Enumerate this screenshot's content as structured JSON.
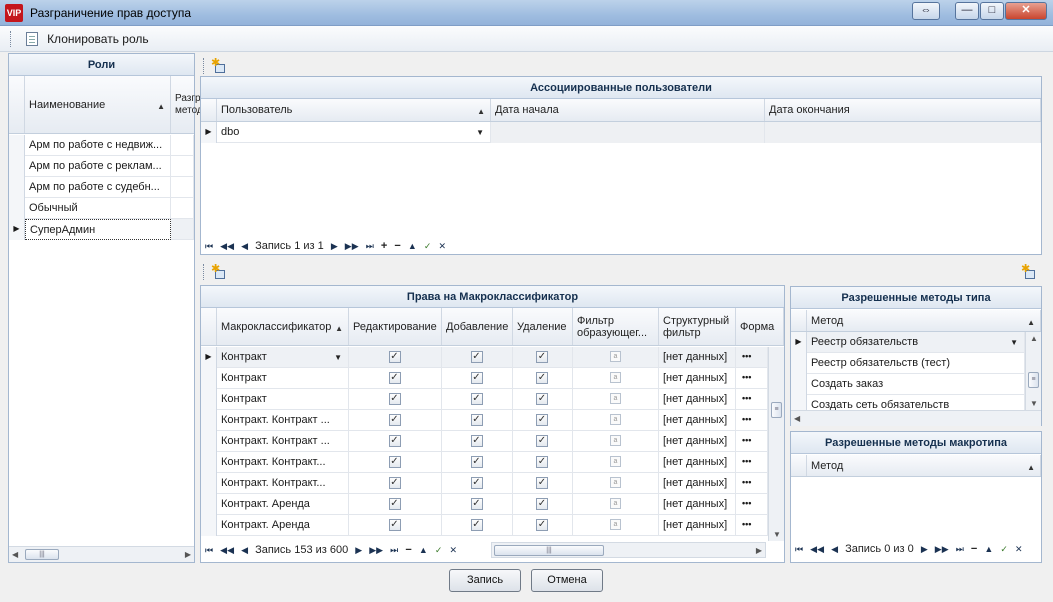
{
  "window": {
    "logo_text": "VIP",
    "title": "Разграничение прав доступа",
    "controls": {
      "restore": "⇔",
      "minimize": "—",
      "maximize": "□",
      "close": "✕"
    }
  },
  "toolbar": {
    "clone_label": "Клонировать роль"
  },
  "roles": {
    "caption": "Роли",
    "columns": [
      "Наименование",
      "Разграничение методов"
    ],
    "rows": [
      "Арм по работе с недвиж...",
      "Арм по работе с реклам...",
      "Арм по работе с судебн...",
      "Обычный",
      "СуперАдмин"
    ],
    "selected_index": 4
  },
  "users": {
    "caption": "Ассоциированные пользователи",
    "columns": [
      "Пользователь",
      "Дата начала",
      "Дата окончания"
    ],
    "rows": [
      {
        "user": "dbo",
        "start": "",
        "end": ""
      }
    ],
    "nav_label": "Запись 1 из 1"
  },
  "rights": {
    "caption": "Права на Макроклассификатор",
    "columns": [
      "Макроклассификатор",
      "Редактирование",
      "Добавление",
      "Удаление",
      "Фильтр образующег...",
      "Структурный фильтр",
      "Форма"
    ],
    "rows": [
      {
        "name": "Контракт",
        "filter": "[нет данных]"
      },
      {
        "name": "Контракт",
        "filter": "[нет данных]"
      },
      {
        "name": "Контракт",
        "filter": "[нет данных]"
      },
      {
        "name": "Контракт. Контракт ...",
        "filter": "[нет данных]"
      },
      {
        "name": "Контракт. Контракт ...",
        "filter": "[нет данных]"
      },
      {
        "name": "Контракт. Контракт...",
        "filter": "[нет данных]"
      },
      {
        "name": "Контракт. Контракт...",
        "filter": "[нет данных]"
      },
      {
        "name": "Контракт. Аренда",
        "filter": "[нет данных]"
      },
      {
        "name": "Контракт. Аренда",
        "filter": "[нет данных]"
      }
    ],
    "nav_label": "Запись 153 из 600"
  },
  "type_methods": {
    "caption": "Разрешенные методы типа",
    "column": "Метод",
    "rows": [
      "Реестр обязательств",
      "Реестр обязательств (тест)",
      "Создать заказ",
      "Создать сеть обязательств"
    ]
  },
  "macro_methods": {
    "caption": "Разрешенные методы макротипа",
    "column": "Метод",
    "nav_label": "Запись 0 из 0"
  },
  "footer": {
    "save_label": "Запись",
    "cancel_label": "Отмена"
  },
  "icons": {
    "first": "⏮",
    "prev_page": "◀◀",
    "prev": "◀",
    "next": "▶",
    "next_page": "▶▶",
    "last": "⏭",
    "add": "+",
    "remove": "−",
    "up": "▲",
    "apply": "✓",
    "cancel": "✕",
    "check": "✓",
    "ellipsis": "•••",
    "filter": "a"
  }
}
